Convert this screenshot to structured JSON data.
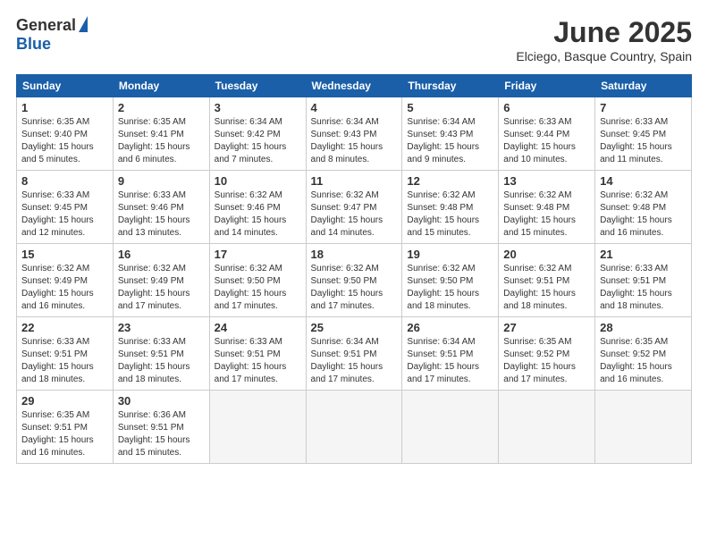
{
  "header": {
    "logo_general": "General",
    "logo_blue": "Blue",
    "main_title": "June 2025",
    "subtitle": "Elciego, Basque Country, Spain"
  },
  "calendar": {
    "days_of_week": [
      "Sunday",
      "Monday",
      "Tuesday",
      "Wednesday",
      "Thursday",
      "Friday",
      "Saturday"
    ],
    "weeks": [
      [
        null,
        {
          "day": "2",
          "sunrise": "6:35 AM",
          "sunset": "9:41 PM",
          "daylight": "15 hours and 6 minutes."
        },
        {
          "day": "3",
          "sunrise": "6:34 AM",
          "sunset": "9:42 PM",
          "daylight": "15 hours and 7 minutes."
        },
        {
          "day": "4",
          "sunrise": "6:34 AM",
          "sunset": "9:43 PM",
          "daylight": "15 hours and 8 minutes."
        },
        {
          "day": "5",
          "sunrise": "6:34 AM",
          "sunset": "9:43 PM",
          "daylight": "15 hours and 9 minutes."
        },
        {
          "day": "6",
          "sunrise": "6:33 AM",
          "sunset": "9:44 PM",
          "daylight": "15 hours and 10 minutes."
        },
        {
          "day": "7",
          "sunrise": "6:33 AM",
          "sunset": "9:45 PM",
          "daylight": "15 hours and 11 minutes."
        }
      ],
      [
        {
          "day": "1",
          "sunrise": "6:35 AM",
          "sunset": "9:40 PM",
          "daylight": "15 hours and 5 minutes."
        },
        null,
        null,
        null,
        null,
        null,
        null
      ],
      [
        {
          "day": "8",
          "sunrise": "6:33 AM",
          "sunset": "9:45 PM",
          "daylight": "15 hours and 12 minutes."
        },
        {
          "day": "9",
          "sunrise": "6:33 AM",
          "sunset": "9:46 PM",
          "daylight": "15 hours and 13 minutes."
        },
        {
          "day": "10",
          "sunrise": "6:32 AM",
          "sunset": "9:46 PM",
          "daylight": "15 hours and 14 minutes."
        },
        {
          "day": "11",
          "sunrise": "6:32 AM",
          "sunset": "9:47 PM",
          "daylight": "15 hours and 14 minutes."
        },
        {
          "day": "12",
          "sunrise": "6:32 AM",
          "sunset": "9:48 PM",
          "daylight": "15 hours and 15 minutes."
        },
        {
          "day": "13",
          "sunrise": "6:32 AM",
          "sunset": "9:48 PM",
          "daylight": "15 hours and 15 minutes."
        },
        {
          "day": "14",
          "sunrise": "6:32 AM",
          "sunset": "9:48 PM",
          "daylight": "15 hours and 16 minutes."
        }
      ],
      [
        {
          "day": "15",
          "sunrise": "6:32 AM",
          "sunset": "9:49 PM",
          "daylight": "15 hours and 16 minutes."
        },
        {
          "day": "16",
          "sunrise": "6:32 AM",
          "sunset": "9:49 PM",
          "daylight": "15 hours and 17 minutes."
        },
        {
          "day": "17",
          "sunrise": "6:32 AM",
          "sunset": "9:50 PM",
          "daylight": "15 hours and 17 minutes."
        },
        {
          "day": "18",
          "sunrise": "6:32 AM",
          "sunset": "9:50 PM",
          "daylight": "15 hours and 17 minutes."
        },
        {
          "day": "19",
          "sunrise": "6:32 AM",
          "sunset": "9:50 PM",
          "daylight": "15 hours and 18 minutes."
        },
        {
          "day": "20",
          "sunrise": "6:32 AM",
          "sunset": "9:51 PM",
          "daylight": "15 hours and 18 minutes."
        },
        {
          "day": "21",
          "sunrise": "6:33 AM",
          "sunset": "9:51 PM",
          "daylight": "15 hours and 18 minutes."
        }
      ],
      [
        {
          "day": "22",
          "sunrise": "6:33 AM",
          "sunset": "9:51 PM",
          "daylight": "15 hours and 18 minutes."
        },
        {
          "day": "23",
          "sunrise": "6:33 AM",
          "sunset": "9:51 PM",
          "daylight": "15 hours and 18 minutes."
        },
        {
          "day": "24",
          "sunrise": "6:33 AM",
          "sunset": "9:51 PM",
          "daylight": "15 hours and 17 minutes."
        },
        {
          "day": "25",
          "sunrise": "6:34 AM",
          "sunset": "9:51 PM",
          "daylight": "15 hours and 17 minutes."
        },
        {
          "day": "26",
          "sunrise": "6:34 AM",
          "sunset": "9:51 PM",
          "daylight": "15 hours and 17 minutes."
        },
        {
          "day": "27",
          "sunrise": "6:35 AM",
          "sunset": "9:52 PM",
          "daylight": "15 hours and 17 minutes."
        },
        {
          "day": "28",
          "sunrise": "6:35 AM",
          "sunset": "9:52 PM",
          "daylight": "15 hours and 16 minutes."
        }
      ],
      [
        {
          "day": "29",
          "sunrise": "6:35 AM",
          "sunset": "9:51 PM",
          "daylight": "15 hours and 16 minutes."
        },
        {
          "day": "30",
          "sunrise": "6:36 AM",
          "sunset": "9:51 PM",
          "daylight": "15 hours and 15 minutes."
        },
        null,
        null,
        null,
        null,
        null
      ]
    ]
  }
}
